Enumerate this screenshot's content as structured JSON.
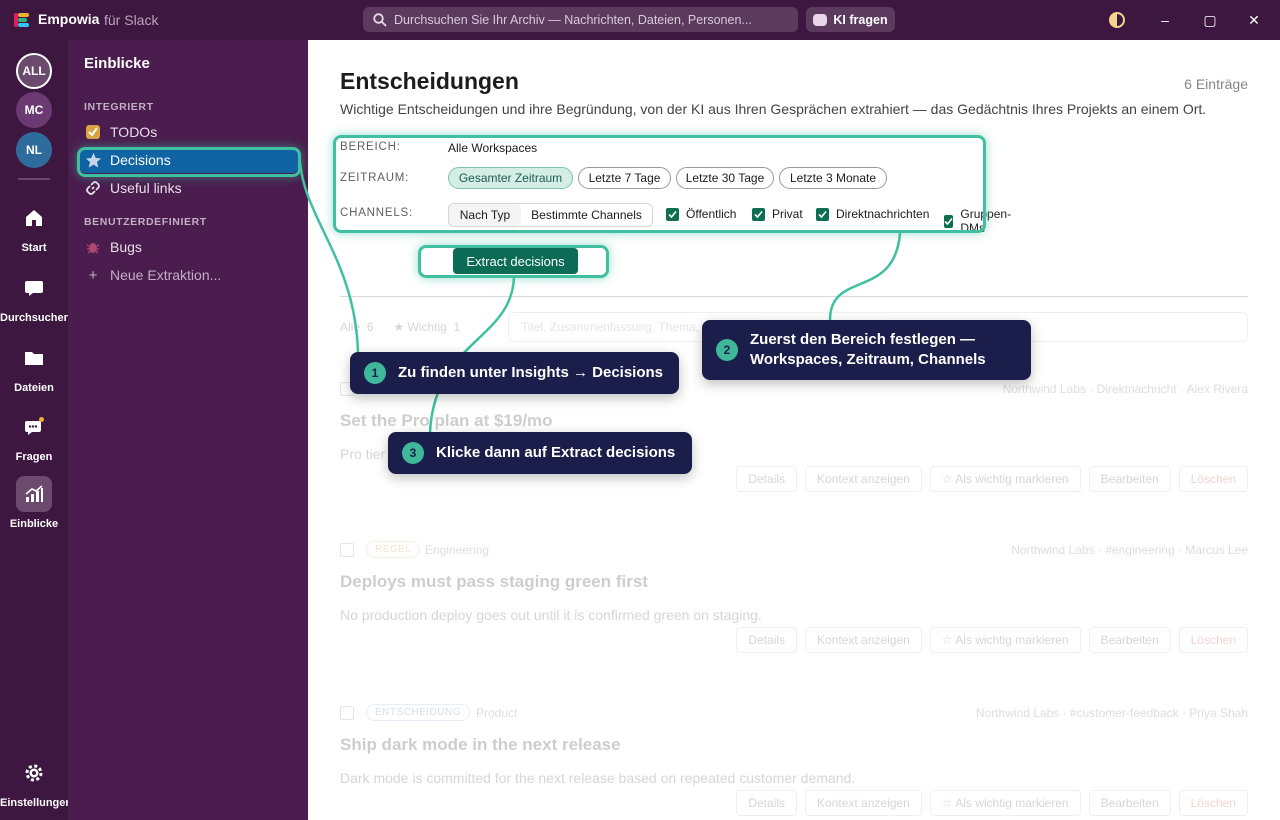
{
  "app": {
    "name": "Empowia",
    "subtitle": "für Slack"
  },
  "search": {
    "placeholder": "Durchsuchen Sie Ihr Archiv — Nachrichten, Dateien, Personen..."
  },
  "ki_button": {
    "label": "KI fragen"
  },
  "window_controls": {
    "minimize": "–",
    "maximize": "▢",
    "close": "✕"
  },
  "workspaces": [
    {
      "label": "ALL"
    },
    {
      "label": "MC"
    },
    {
      "label": "NL"
    }
  ],
  "rail": {
    "start": "Start",
    "search": "Durchsuchen",
    "files": "Dateien",
    "ask": "Fragen",
    "insights": "Einblicke",
    "settings": "Einstellungen"
  },
  "sidebar": {
    "title": "Einblicke",
    "section_integrated": "INTEGRIERT",
    "section_custom": "BENUTZERDEFINIERT",
    "items": [
      {
        "label": "TODOs",
        "icon": "checkbox-icon"
      },
      {
        "label": "Decisions",
        "icon": "star-icon"
      },
      {
        "label": "Useful links",
        "icon": "link-icon"
      },
      {
        "label": "Bugs",
        "icon": "bug-icon"
      },
      {
        "label": "Neue Extraktion...",
        "icon": "plus-icon"
      }
    ]
  },
  "main": {
    "title": "Entscheidungen",
    "count": "6 Einträge",
    "subtitle": "Wichtige Entscheidungen und ihre Begründung, von der KI aus Ihren Gesprächen extrahiert — das Gedächtnis Ihres Projekts an einem Ort.",
    "filters": {
      "scope_label": "BEREICH:",
      "scope_value": "Alle Workspaces",
      "period_label": "ZEITRAUM:",
      "periods": [
        "Gesamter Zeitraum",
        "Letzte 7 Tage",
        "Letzte 30 Tage",
        "Letzte 3 Monate"
      ],
      "channels_label": "CHANNELS:",
      "channel_modes": [
        "Nach Typ",
        "Bestimmte Channels"
      ],
      "channel_types": [
        "Öffentlich",
        "Privat",
        "Direktnachrichten",
        "Gruppen-DMs"
      ]
    },
    "extract_button": "Extract decisions",
    "list": {
      "tab_all": "Alle",
      "tab_all_count": "6",
      "tab_important": "★ Wichtig",
      "tab_important_count": "1",
      "filter_placeholder": "Titel, Zusammenfassung, Thema, R",
      "actions": {
        "details": "Details",
        "context": "Kontext anzeigen",
        "mark": "☆ Als wichtig markieren",
        "edit": "Bearbeiten",
        "delete": "Löschen"
      },
      "cards": [
        {
          "tag": "",
          "category": "",
          "meta": "Northwind Labs · Direktnachricht · Alex Rivera",
          "title": "Set the Pro plan at $19/mo",
          "summary": "Pro tier"
        },
        {
          "tag": "REGEL",
          "category": "Engineering",
          "meta": "Northwind Labs · #engineering · Marcus Lee",
          "title": "Deploys must pass staging green first",
          "summary": "No production deploy goes out until it is confirmed green on staging."
        },
        {
          "tag": "ENTSCHEIDUNG",
          "category": "Product",
          "meta": "Northwind Labs · #customer-feedback · Priya Shah",
          "title": "Ship dark mode in the next release",
          "summary": "Dark mode is committed for the next release based on repeated customer demand."
        }
      ]
    }
  },
  "callouts": [
    {
      "num": "1",
      "text": "Zu finden unter Insights → Decisions"
    },
    {
      "num": "2",
      "line1": "Zuerst den Bereich festlegen —",
      "line2": "Workspaces, Zeitraum, Channels"
    },
    {
      "num": "3",
      "text": "Klicke dann auf Extract decisions"
    }
  ],
  "colors": {
    "rail": "#3d1740",
    "sidebar": "#4a1d4e",
    "active": "#1164a3",
    "accent": "#0b6b55",
    "highlight": "#3fc0a0",
    "callout": "#1b1e4a"
  }
}
